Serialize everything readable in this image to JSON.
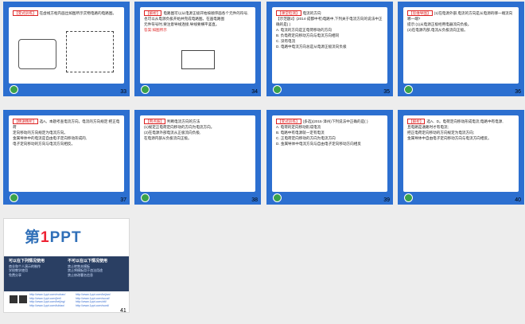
{
  "slides": [
    {
      "num": "33",
      "tag": "【变式训练】",
      "lines": [
        "在虚线方框内画出如图所示实物电路的电路图。"
      ]
    },
    {
      "num": "34",
      "tag": "【解析】",
      "lines": [
        "电路图可以从电源正极开始按顺序画各个元件的符号,",
        "也可以从电源负极开始并完成电路图。在画电路图",
        "元件符号时,要注意导线连接,导线要横平竖直。"
      ],
      "answer": "答案:如图所示"
    },
    {
      "num": "35",
      "tag": "【课堂检测】",
      "lines": [
        "电流的方向",
        "【示范题2】(2014·成都中考)电路中,下列关于电流方向的说法中正确的是(  )",
        "A. 电流的方向是正电荷移动的方向",
        "B. 负电荷定向移动方向与电流方向相同",
        "C. 没有电流",
        "D. 电路中电流方向总是从电源正极流向负极"
      ]
    },
    {
      "num": "36",
      "tag": "【思维导图】",
      "lines": [
        "(1)在电源外部,电流的方向是从电源的哪一端流向哪一端?",
        "提示:(1)从电源正极经用电器流向负极。",
        "(2)在电源内部,电流从负极流向正极。"
      ]
    },
    {
      "num": "37",
      "tag": "【精讲精析】",
      "lines": [
        "选A。本题考查电流方向。电流的方向规定:把正电荷",
        "定向移动的方向规定为电流方向。",
        "金属导体中的电流是自由电子定向移动形成的,",
        "电子定向移动的方向与电流方向相反。"
      ]
    },
    {
      "num": "38",
      "tag": "【用点拨】",
      "lines": [
        "判断电流方向的方法",
        "(1)规定正电荷定向移动的方向为电流方向。",
        "(2)在电源外部电流从正极流向负极,",
        "在电源内部从负极流向正极。"
      ]
    },
    {
      "num": "39",
      "tag": "【变式训练】",
      "lines": [
        "(多选)(2015·漳州)下列说法中正确的是(  )",
        "A. 电荷的定向移动形成电流",
        "B. 电路中有电源就一定有电流",
        "C. 正电荷定向移动的方向为电流方向",
        "D. 金属导体中电流方向与自由电子定向移动方向相反"
      ]
    },
    {
      "num": "40",
      "tag": "【解析】",
      "lines": [
        "选A、D。电荷定向移动形成电流;电路中有电源,",
        "且电路是通路时才有电流;",
        "把正电荷定向移动的方向规定为电流方向;",
        "金属导体中自由电子定向移动方向与电流方向相反。"
      ]
    }
  ],
  "last_slide": {
    "num": "41",
    "logo_prefix": "第",
    "logo_one": "1",
    "logo_suffix": "PPT",
    "col1_title": "可以在下列情况使用",
    "col1_lines": [
      "商业和个人演示的制作",
      "学校教学使用",
      "免费分享"
    ],
    "col2_title": "不可以在以下情况使用",
    "col2_lines": [
      "禁止转售本模板",
      "禁止将模板用于违法用途",
      "禁止修改署名信息"
    ],
    "links_left": [
      "http://www.1ppt.com/moban/",
      "http://www.1ppt.com/jieri/",
      "http://www.1ppt.com/beijing/",
      "http://www.1ppt.com/tubiao/",
      "http://www.1ppt.com/excel/"
    ],
    "links_right": [
      "http://www.1ppt.com/kejian/",
      "http://www.1ppt.com/sucai/",
      "http://www.1ppt.com/ziti/",
      "http://www.1ppt.com/word/",
      "http://www.1ppt.com/shouchaobao/"
    ]
  }
}
